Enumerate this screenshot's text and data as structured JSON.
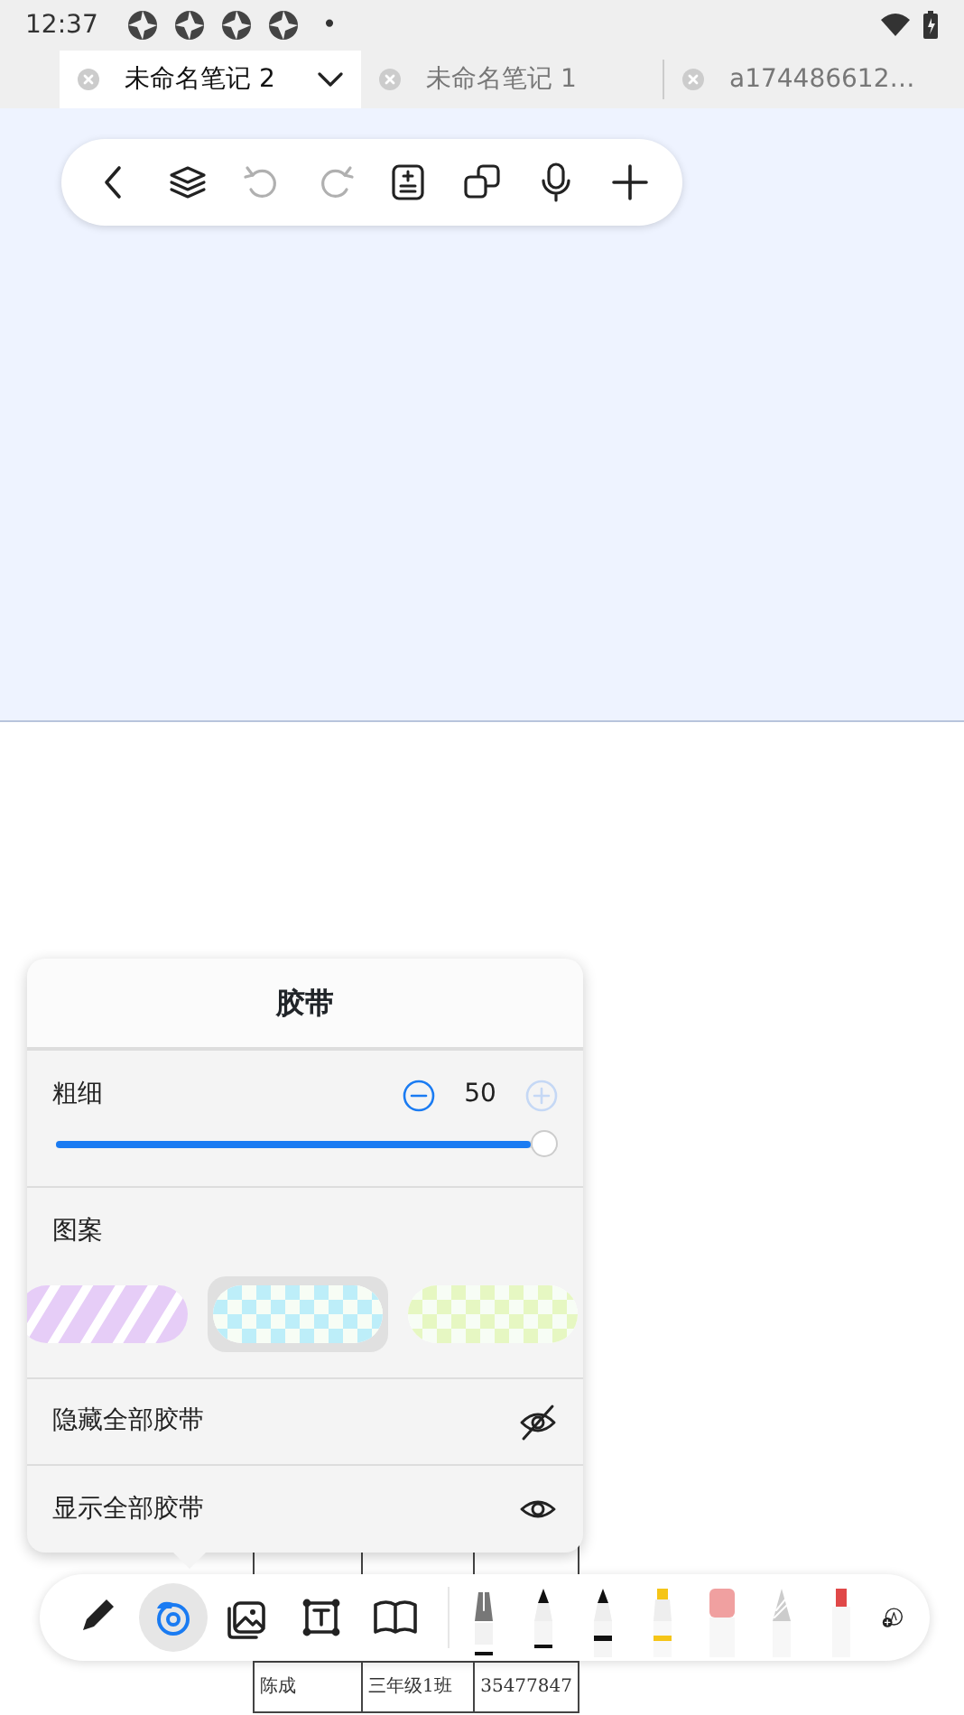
{
  "status_bar": {
    "time": "12:37",
    "notification_count_dot": "•"
  },
  "tabs": [
    {
      "label": "未命名笔记 2",
      "selected": true
    },
    {
      "label": "未命名笔记 1",
      "selected": false
    },
    {
      "label": "a174486612…",
      "selected": false
    }
  ],
  "top_toolbar": [
    {
      "kind": "back",
      "disabled": false
    },
    {
      "kind": "layers",
      "disabled": false
    },
    {
      "kind": "undo",
      "disabled": true
    },
    {
      "kind": "redo",
      "disabled": true
    },
    {
      "kind": "document",
      "disabled": false
    },
    {
      "kind": "copy",
      "disabled": false
    },
    {
      "kind": "mic",
      "disabled": false
    },
    {
      "kind": "add",
      "disabled": false
    }
  ],
  "tape_panel": {
    "title": "胶带",
    "thickness": {
      "label": "粗细",
      "value": "50",
      "level": 1.0,
      "minus_disabled": false,
      "plus_disabled": true
    },
    "pattern_label": "图案",
    "patterns": [
      {
        "kind": "stripes",
        "color": "#e6cdf7",
        "selected": false
      },
      {
        "kind": "checker",
        "color": "#bdeef9",
        "selected": true
      },
      {
        "kind": "checker",
        "color": "#e6f7c2",
        "selected": false
      }
    ],
    "actions": [
      {
        "label": "隐藏全部胶带",
        "kind": "hide"
      },
      {
        "label": "显示全部胶带",
        "kind": "show"
      }
    ]
  },
  "table": {
    "rows": [
      [
        "",
        "",
        ""
      ],
      [
        "陈成",
        "三年级1班",
        "35477847"
      ]
    ]
  },
  "bottom_toolbar": [
    {
      "kind": "pen",
      "selected": false
    },
    {
      "kind": "tape",
      "selected": true
    },
    {
      "kind": "image",
      "selected": false
    },
    {
      "kind": "textbox",
      "selected": false
    },
    {
      "kind": "book",
      "selected": false
    }
  ]
}
